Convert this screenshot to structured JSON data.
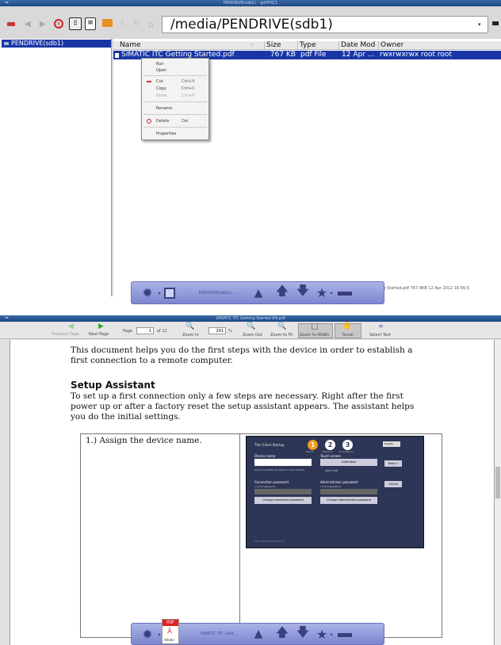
{
  "fm": {
    "window_title": "PENDRIVE(sdb1) - gsHFXC1",
    "path": "/media/PENDRIVE(sdb1)",
    "tree_item": "PENDRIVE(sdb1)",
    "columns": [
      "Name",
      "Size",
      "Type",
      "Date Mod",
      "Owner"
    ],
    "row": {
      "name": "SIMATIC ITC Getting Started.pdf",
      "size": "767 KB",
      "type": "pdf File",
      "date": "12 Apr ...",
      "owner": "rwxrwxrwx root root"
    },
    "menu": [
      {
        "label": "Run",
        "shortcut": ""
      },
      {
        "label": "Open",
        "shortcut": ""
      },
      {
        "label": "Cut",
        "shortcut": "Ctrl+X"
      },
      {
        "label": "Copy",
        "shortcut": "Ctrl+C"
      },
      {
        "label": "Paste",
        "shortcut": "Ctrl+V"
      },
      {
        "label": "Rename",
        "shortcut": ""
      },
      {
        "label": "Delete",
        "shortcut": "Del"
      },
      {
        "label": "Properties",
        "shortcut": ""
      }
    ],
    "status": "ng Started.pdf   767.4KB   12 Apr 2012 16:56:5",
    "dock_task": "PENDRIVE(sdb1) - ..."
  },
  "pdf": {
    "window_title": "SIMATIC ITC Getting Started EN.pdf",
    "toolbar": {
      "prev": "Previous Page",
      "next": "Next Page",
      "page_label": "Page",
      "page_value": "1",
      "of": "of 12",
      "zoom_in": "Zoom In",
      "zoom_value": "201",
      "zoom_pct": "%",
      "zoom_out": "Zoom Out",
      "zoom_fit": "Zoom to Fit",
      "zoom_width": "Zoom to Width",
      "scroll": "Scroll",
      "select": "Select Text"
    },
    "para1": "This document helps you do the first steps with the device in order to establish a first connection to a remote computer.",
    "heading": "Setup Assistant",
    "para2": "To set up a first connection only a few steps are necessary. Right after the first power up or after a factory reset the setup assistant appears. The assistant helps you do the initial settings.",
    "step1": "1.) Assign the device name.",
    "dock_task": "SIMATIC ITC Gett...",
    "pdf_badge": "PDF",
    "adobe": "Adobe",
    "shot": {
      "title": "Thin Client Startup",
      "lang": "English",
      "steps": [
        "1",
        "2",
        "3"
      ],
      "step_labels": [
        "Basics",
        "Network",
        "Connections"
      ],
      "device_name": "Device name",
      "device_hint": "Used to identify the device in the network",
      "touch": "Touch screen",
      "calibration": "Calibration",
      "right_mat": "right mat",
      "conn_pw": "Connection password",
      "current_pw": "current password",
      "change_conn": "Change connection password",
      "admin_pw": "Administrator password",
      "change_admin": "Change administrator password",
      "next": "Next >",
      "cancel": "Cancel",
      "footer": "Start: 00-00-00-00-00-00"
    }
  }
}
